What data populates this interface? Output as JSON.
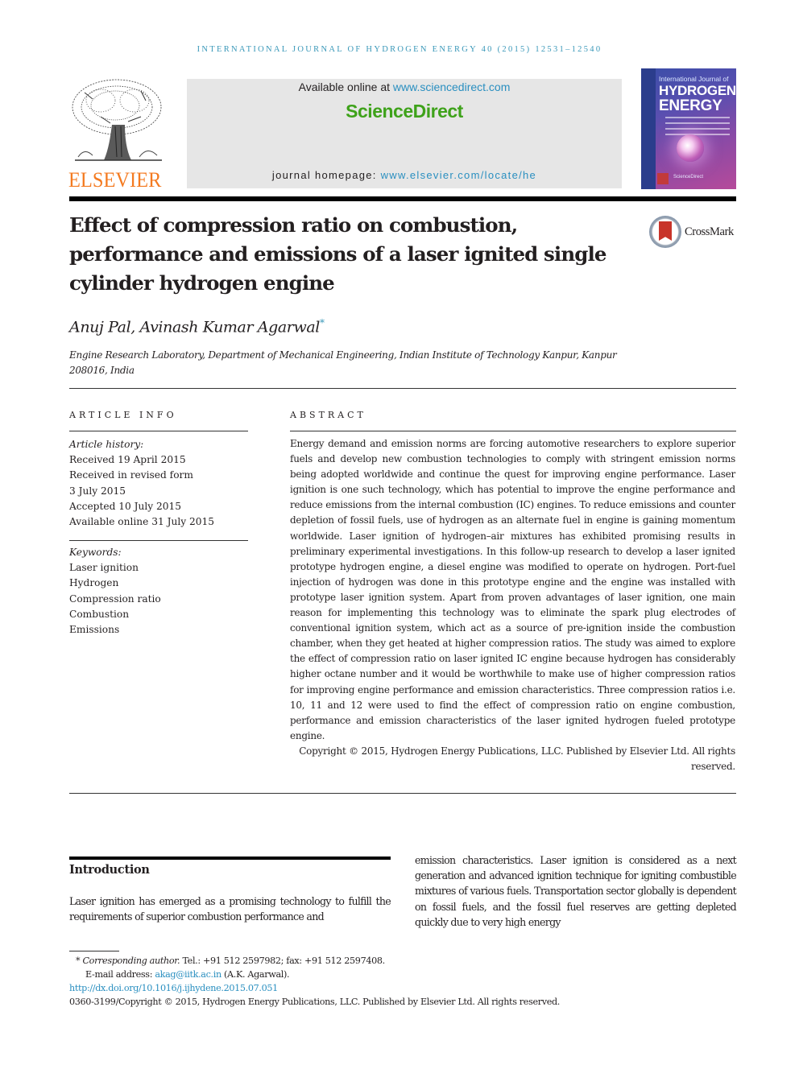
{
  "running_head": "INTERNATIONAL JOURNAL OF HYDROGEN ENERGY 40 (2015) 12531–12540",
  "publisher": {
    "logo_word": "ELSEVIER",
    "available_prefix": "Available online at ",
    "available_link": "www.sciencedirect.com",
    "platform_name": "ScienceDirect",
    "homepage_prefix": "journal homepage: ",
    "homepage_link": "www.elsevier.com/locate/he"
  },
  "journal_cover": {
    "line1": "International Journal of",
    "line2": "HYDROGEN",
    "line3": "ENERGY",
    "footer": "ScienceDirect"
  },
  "crossmark_label": "CrossMark",
  "article": {
    "title": "Effect of compression ratio on combustion, performance and emissions of a laser ignited single cylinder hydrogen engine",
    "authors": "Anuj Pal, Avinash Kumar Agarwal",
    "corresponding_marker": "*",
    "affiliation_line1": "Engine Research Laboratory, Department of Mechanical Engineering, Indian Institute of Technology Kanpur, Kanpur",
    "affiliation_line2": "208016, India"
  },
  "article_info": {
    "heading": "ARTICLE INFO",
    "history_label": "Article history:",
    "history": [
      "Received 19 April 2015",
      "Received in revised form",
      "3 July 2015",
      "Accepted 10 July 2015",
      "Available online 31 July 2015"
    ],
    "keywords_label": "Keywords:",
    "keywords": [
      "Laser ignition",
      "Hydrogen",
      "Compression ratio",
      "Combustion",
      "Emissions"
    ]
  },
  "abstract": {
    "heading": "ABSTRACT",
    "body": "Energy demand and emission norms are forcing automotive researchers to explore supe­rior fuels and develop new combustion technologies to comply with stringent emission norms being adopted worldwide and continue the quest for improving engine perfor­mance. Laser ignition is one such technology, which has potential to improve the engine performance and reduce emissions from the internal combustion (IC) engines. To reduce emissions and counter depletion of fossil fuels, use of hydrogen as an alternate fuel in engine is gaining momentum worldwide. Laser ignition of hydrogen–air mixtures has exhibited promising results in preliminary experimental investigations. In this follow-up research to develop a laser ignited prototype hydrogen engine, a diesel engine was modi­fied to operate on hydrogen. Port-fuel injection of hydrogen was done in this prototype engine and the engine was installed with prototype laser ignition system. Apart from proven advantages of laser ignition, one main reason for implementing this technology was to eliminate the spark plug electrodes of conventional ignition system, which act as a source of pre-ignition inside the combustion chamber, when they get heated at higher compression ratios. The study was aimed to explore the effect of compression ratio on laser ignited IC engine because hydrogen has considerably higher octane number and it would be worthwhile to make use of higher compression ratios for improving engine performance and emission characteristics. Three compression ratios i.e. 10, 11 and 12 were used to find the effect of compression ratio on engine combustion, performance and emission characteristics of the laser ignited hydrogen fueled prototype engine.",
    "copyright": "Copyright © 2015, Hydrogen Energy Publications, LLC. Published by Elsevier Ltd. All rights reserved."
  },
  "introduction": {
    "heading": "Introduction",
    "left_text": "Laser ignition has emerged as a promising technology to fulfill the requirements of superior combustion performance and",
    "right_text": "emission characteristics. Laser ignition is considered as a next generation and advanced ignition technique for igniting combustible mixtures of various fuels. Transportation sector globally is dependent on fossil fuels, and the fossil fuel re­serves are getting depleted quickly due to very high energy"
  },
  "footnotes": {
    "marker": "*",
    "corresponding_label": "Corresponding author.",
    "contact": " Tel.: +91 512 2597982; fax: +91 512 2597408.",
    "email_label": "E-mail address: ",
    "email": "akag@iitk.ac.in",
    "email_suffix": " (A.K. Agarwal).",
    "doi": "http://dx.doi.org/10.1016/j.ijhydene.2015.07.051",
    "copyright": "0360-3199/Copyright © 2015, Hydrogen Energy Publications, LLC. Published by Elsevier Ltd. All rights reserved."
  }
}
